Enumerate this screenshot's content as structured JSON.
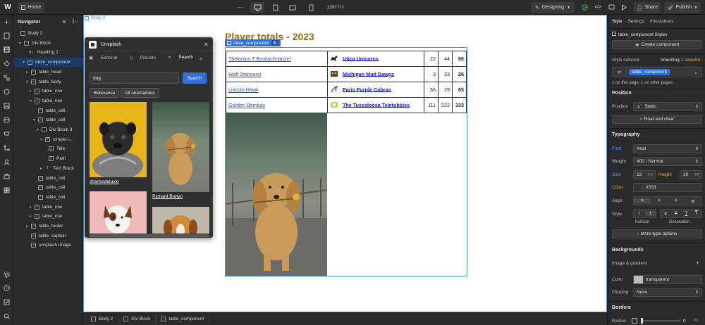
{
  "topbar": {
    "home_label": "Home",
    "width_value": "1297",
    "width_unit": "PX",
    "mode_label": "Designing",
    "share_label": "Share",
    "publish_label": "Publish"
  },
  "navigator": {
    "title": "Navigator",
    "items": [
      {
        "label": "Body 2"
      },
      {
        "label": "Div Block"
      },
      {
        "label": "Heading 2"
      },
      {
        "label": "table_component"
      },
      {
        "label": "table_head"
      },
      {
        "label": "table_body"
      },
      {
        "label": "table_row"
      },
      {
        "label": "table_row"
      },
      {
        "label": "table_cell"
      },
      {
        "label": "table_cell"
      },
      {
        "label": "Div Block 3"
      },
      {
        "label": "simple-i..."
      },
      {
        "label": "Title"
      },
      {
        "label": "Path"
      },
      {
        "label": "Text Block"
      },
      {
        "label": "table_cell"
      },
      {
        "label": "table_cell"
      },
      {
        "label": "table_cell"
      },
      {
        "label": "table_row"
      },
      {
        "label": "table_row"
      },
      {
        "label": "table_footer"
      },
      {
        "label": "table_caption"
      },
      {
        "label": "unsplash-image"
      }
    ]
  },
  "canvas": {
    "body_tag": "Body 2",
    "selected_tag": "table_component",
    "heading": "Player totals - 2023",
    "rows": [
      {
        "player": "Thelonius T Bookschnauzer",
        "team": "Utica Unicorns",
        "a": "22",
        "b": "44",
        "total": "66"
      },
      {
        "player": "Wolf Stansson",
        "team": "Michigan Mud Dawgs",
        "a": "3",
        "b": "23",
        "total": "26"
      },
      {
        "player": "Lincoln Hawk",
        "team": "Paris Purple Cobras",
        "a": "36",
        "b": "29",
        "total": "65"
      },
      {
        "player": "Gordon Bombay",
        "team": "The Tuscaloosa Teletubbies",
        "a": "111",
        "b": "222",
        "total": "333"
      }
    ]
  },
  "unsplash": {
    "title": "Unsplash",
    "tabs": [
      "Editorial",
      "Presets",
      "Search"
    ],
    "search_value": "dog",
    "search_button": "Search",
    "filter_relevance": "Relevance",
    "filter_orientation": "All orientations",
    "photo_credit_1": "charlesdeluvio",
    "photo_credit_2": "Richard Brutyo"
  },
  "breadcrumbs": [
    "Body 2",
    "Div Block",
    "table_component"
  ],
  "style_panel": {
    "tabs": [
      "Style",
      "Settings",
      "Interactions"
    ],
    "styles_label": "table_component Styles",
    "create_component": "Create component",
    "selector_label": "Style selector",
    "inheriting": "Inheriting",
    "inheriting_count": "1 selector",
    "selector_chip": "table_component",
    "usage_note": "1 on this page, 1 on other pages.",
    "position_title": "Position",
    "position_label": "Position",
    "position_value": "Static",
    "float_clear": "Float and clear",
    "typography_title": "Typography",
    "font_label": "Font",
    "font_value": "Arial",
    "weight_label": "Weight",
    "weight_value": "400 - Normal",
    "size_label": "Size",
    "size_value": "13",
    "size_unit": "PX",
    "height_label": "Height",
    "height_value": "20",
    "height_unit": "PX",
    "color_label": "Color",
    "color_value": "#333",
    "align_label": "Align",
    "style_label": "Style",
    "italicize_label": "Italicize",
    "decoration_label": "Decoration",
    "more_type": "More type options",
    "backgrounds_title": "Backgrounds",
    "image_gradient": "Image & gradient",
    "bg_color_label": "Color",
    "bg_color_value": "transparent",
    "clipping_label": "Clipping",
    "clipping_value": "None",
    "borders_title": "Borders",
    "radius_label": "Radius",
    "radius_value": "0",
    "radius_unit": "PX"
  },
  "colors": {
    "accent": "#2f6fde",
    "heading": "#9a6a10",
    "canvas_bg": "#ffffff"
  }
}
